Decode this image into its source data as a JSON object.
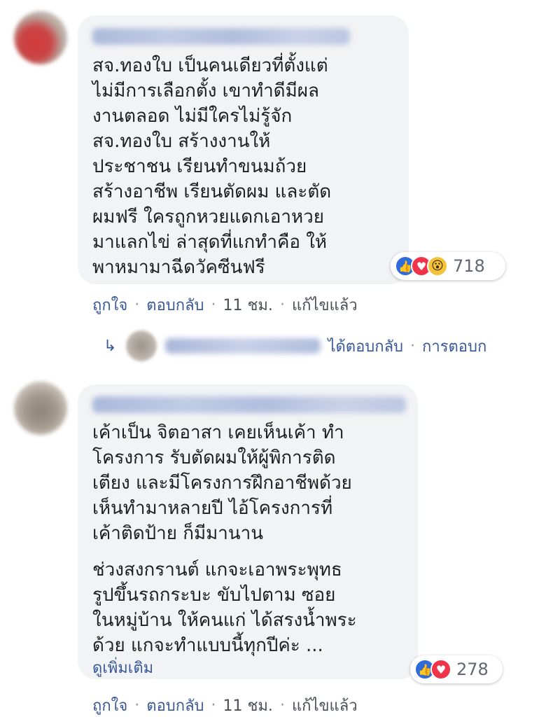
{
  "comments": [
    {
      "text": "สจ.ทองใบ เป็นคนเดียวที่ตั้งแต่\nไม่มีการเลือกตั้ง เขาทำดีมีผล\nงานตลอด ไม่มีใครไม่รู้จัก\nสจ.ทองใบ สร้างงานให้\nประชาชน เรียนทำขนมถ้วย\nสร้างอาชีพ เรียนตัดผม และตัด\nผมฟรี ใครถูกหวยแดกเอาหวย\nมาแลกไข่ ล่าสุดที่แกทำคือ ให้\nพาหมามาฉีดวัคซีนฟรี",
      "reaction_count": "718",
      "reactions": [
        "like-icon",
        "love-icon",
        "wow-icon"
      ],
      "actions": {
        "like": "ถูกใจ",
        "reply": "ตอบกลับ",
        "time": "11 ชม.",
        "edited": "แก้ไขแล้ว"
      }
    },
    {
      "paragraph1": "เค้าเป็น จิตอาสา เคยเห็นเค้า ทำ\nโครงการ รับตัดผมให้ผู้พิการติด\nเตียง และมีโครงการฝึกอาชีพด้วย\nเห็นทำมาหลายปี ไอ้โครงการที่\nเค้าติดป้าย ก็มีมานาน",
      "paragraph2": "ช่วงสงกรานต์ แกจะเอาพระพุทธ\nรูปขึ้นรถกระบะ ขับไปตาม ซอย\nในหมู่บ้าน ให้คนแก่ ได้สรงน้ำพระ\nด้วย แกจะทำแบบนี้ทุกปีค่ะ ...",
      "see_more": "ดูเพิ่มเติม",
      "reaction_count": "278",
      "reactions": [
        "like-icon",
        "love-icon"
      ],
      "actions": {
        "like": "ถูกใจ",
        "reply": "ตอบกลับ",
        "time": "11 ชม.",
        "edited": "แก้ไขแล้ว"
      }
    }
  ],
  "reply_summary": {
    "replied": "ได้ตอบกลับ",
    "replies": "การตอบก"
  },
  "colors": {
    "bubble": "#f2f3f5",
    "link": "#385898",
    "like": "#2f6bd9",
    "love": "#f0344a",
    "wow": "#f5c33b"
  }
}
